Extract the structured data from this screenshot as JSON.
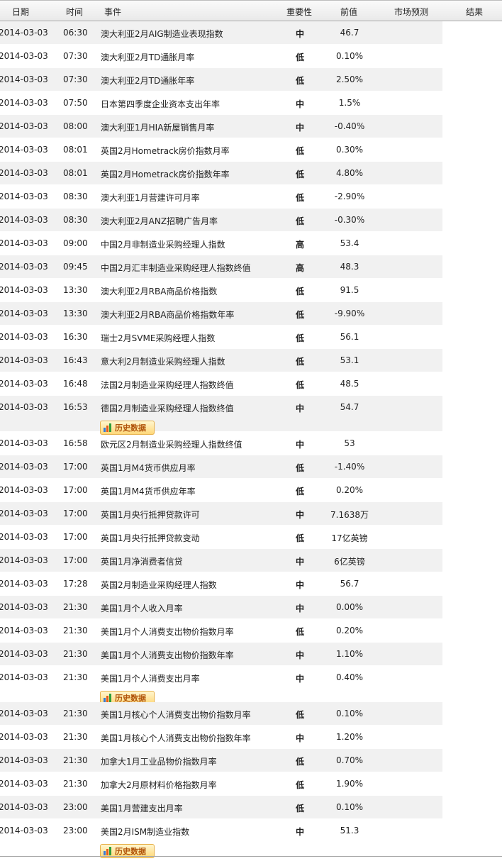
{
  "headers": {
    "date": "日期",
    "time": "时间",
    "event": "事件",
    "importance": "重要性",
    "previous": "前值",
    "forecast": "市场预测",
    "result": "结果"
  },
  "history_label": "历史数据",
  "importance_colors": {
    "high": "#d11414",
    "mid": "#0a2bb8",
    "low": "#0a8a1d"
  },
  "rows": [
    {
      "date": "2014-03-03",
      "time": "06:30",
      "event": "澳大利亚2月AIG制造业表现指数",
      "importance": "中",
      "level": "mid",
      "previous": "46.7",
      "history": false
    },
    {
      "date": "2014-03-03",
      "time": "07:30",
      "event": "澳大利亚2月TD通胀月率",
      "importance": "低",
      "level": "low",
      "previous": "0.10%",
      "history": false
    },
    {
      "date": "2014-03-03",
      "time": "07:30",
      "event": "澳大利亚2月TD通胀年率",
      "importance": "低",
      "level": "low",
      "previous": "2.50%",
      "history": false
    },
    {
      "date": "2014-03-03",
      "time": "07:50",
      "event": "日本第四季度企业资本支出年率",
      "importance": "中",
      "level": "mid",
      "previous": "1.5%",
      "history": false
    },
    {
      "date": "2014-03-03",
      "time": "08:00",
      "event": "澳大利亚1月HIA新屋销售月率",
      "importance": "中",
      "level": "mid",
      "previous": "-0.40%",
      "history": false
    },
    {
      "date": "2014-03-03",
      "time": "08:01",
      "event": "英国2月Hometrack房价指数月率",
      "importance": "低",
      "level": "low",
      "previous": "0.30%",
      "history": false
    },
    {
      "date": "2014-03-03",
      "time": "08:01",
      "event": "英国2月Hometrack房价指数年率",
      "importance": "低",
      "level": "low",
      "previous": "4.80%",
      "history": false
    },
    {
      "date": "2014-03-03",
      "time": "08:30",
      "event": "澳大利亚1月营建许可月率",
      "importance": "低",
      "level": "low",
      "previous": "-2.90%",
      "history": false
    },
    {
      "date": "2014-03-03",
      "time": "08:30",
      "event": "澳大利亚2月ANZ招聘广告月率",
      "importance": "低",
      "level": "low",
      "previous": "-0.30%",
      "history": false
    },
    {
      "date": "2014-03-03",
      "time": "09:00",
      "event": "中国2月非制造业采购经理人指数",
      "importance": "高",
      "level": "high",
      "previous": "53.4",
      "history": false
    },
    {
      "date": "2014-03-03",
      "time": "09:45",
      "event": "中国2月汇丰制造业采购经理人指数终值",
      "importance": "高",
      "level": "high",
      "previous": "48.3",
      "history": false
    },
    {
      "date": "2014-03-03",
      "time": "13:30",
      "event": "澳大利亚2月RBA商品价格指数",
      "importance": "低",
      "level": "low",
      "previous": "91.5",
      "history": false
    },
    {
      "date": "2014-03-03",
      "time": "13:30",
      "event": "澳大利亚2月RBA商品价格指数年率",
      "importance": "低",
      "level": "low",
      "previous": "-9.90%",
      "history": false
    },
    {
      "date": "2014-03-03",
      "time": "16:30",
      "event": "瑞士2月SVME采购经理人指数",
      "importance": "低",
      "level": "low",
      "previous": "56.1",
      "history": false
    },
    {
      "date": "2014-03-03",
      "time": "16:43",
      "event": "意大利2月制造业采购经理人指数",
      "importance": "低",
      "level": "low",
      "previous": "53.1",
      "history": false
    },
    {
      "date": "2014-03-03",
      "time": "16:48",
      "event": "法国2月制造业采购经理人指数终值",
      "importance": "低",
      "level": "low",
      "previous": "48.5",
      "history": false
    },
    {
      "date": "2014-03-03",
      "time": "16:53",
      "event": "德国2月制造业采购经理人指数终值",
      "importance": "中",
      "level": "mid",
      "previous": "54.7",
      "history": true
    },
    {
      "date": "2014-03-03",
      "time": "16:58",
      "event": "欧元区2月制造业采购经理人指数终值",
      "importance": "中",
      "level": "mid",
      "previous": "53",
      "history": false
    },
    {
      "date": "2014-03-03",
      "time": "17:00",
      "event": "英国1月M4货币供应月率",
      "importance": "低",
      "level": "low",
      "previous": "-1.40%",
      "history": false
    },
    {
      "date": "2014-03-03",
      "time": "17:00",
      "event": "英国1月M4货币供应年率",
      "importance": "低",
      "level": "low",
      "previous": "0.20%",
      "history": false
    },
    {
      "date": "2014-03-03",
      "time": "17:00",
      "event": "英国1月央行抵押贷款许可",
      "importance": "中",
      "level": "mid",
      "previous": "7.1638万",
      "history": false
    },
    {
      "date": "2014-03-03",
      "time": "17:00",
      "event": "英国1月央行抵押贷款变动",
      "importance": "低",
      "level": "low",
      "previous": "17亿英镑",
      "history": false
    },
    {
      "date": "2014-03-03",
      "time": "17:00",
      "event": "英国1月净消费者信贷",
      "importance": "中",
      "level": "mid",
      "previous": "6亿英镑",
      "history": false
    },
    {
      "date": "2014-03-03",
      "time": "17:28",
      "event": "英国2月制造业采购经理人指数",
      "importance": "中",
      "level": "mid",
      "previous": "56.7",
      "history": false
    },
    {
      "date": "2014-03-03",
      "time": "21:30",
      "event": "美国1月个人收入月率",
      "importance": "中",
      "level": "mid",
      "previous": "0.00%",
      "history": false
    },
    {
      "date": "2014-03-03",
      "time": "21:30",
      "event": "美国1月个人消费支出物价指数月率",
      "importance": "低",
      "level": "low",
      "previous": "0.20%",
      "history": false
    },
    {
      "date": "2014-03-03",
      "time": "21:30",
      "event": "美国1月个人消费支出物价指数年率",
      "importance": "中",
      "level": "mid",
      "previous": "1.10%",
      "history": false
    },
    {
      "date": "2014-03-03",
      "time": "21:30",
      "event": "美国1月个人消费支出月率",
      "importance": "中",
      "level": "mid",
      "previous": "0.40%",
      "history": true
    },
    {
      "date": "2014-03-03",
      "time": "21:30",
      "event": "美国1月核心个人消费支出物价指数月率",
      "importance": "低",
      "level": "low",
      "previous": "0.10%",
      "history": false
    },
    {
      "date": "2014-03-03",
      "time": "21:30",
      "event": "美国1月核心个人消费支出物价指数年率",
      "importance": "中",
      "level": "mid",
      "previous": "1.20%",
      "history": false
    },
    {
      "date": "2014-03-03",
      "time": "21:30",
      "event": "加拿大1月工业品物价指数月率",
      "importance": "低",
      "level": "low",
      "previous": "0.70%",
      "history": false
    },
    {
      "date": "2014-03-03",
      "time": "21:30",
      "event": "加拿大2月原材料价格指数月率",
      "importance": "低",
      "level": "low",
      "previous": "1.90%",
      "history": false
    },
    {
      "date": "2014-03-03",
      "time": "23:00",
      "event": "美国1月营建支出月率",
      "importance": "低",
      "level": "low",
      "previous": "0.10%",
      "history": false
    },
    {
      "date": "2014-03-03",
      "time": "23:00",
      "event": "美国2月ISM制造业指数",
      "importance": "中",
      "level": "mid",
      "previous": "51.3",
      "history": true
    }
  ]
}
